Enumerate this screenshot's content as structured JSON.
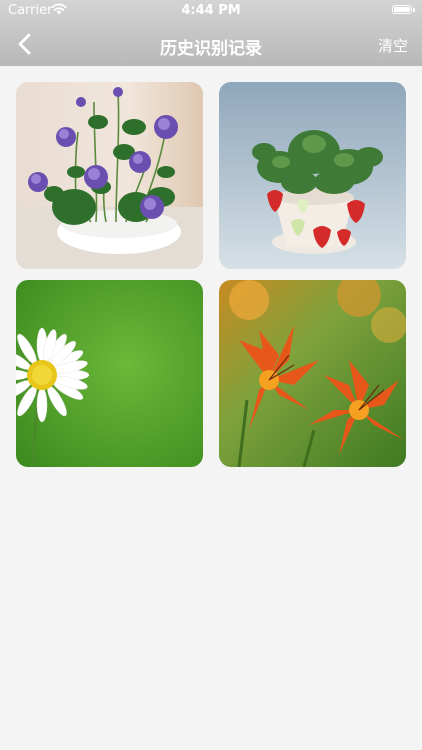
{
  "status_bar": {
    "carrier": "Carrier",
    "time": "4:44 PM"
  },
  "nav": {
    "title": "历史识别记录",
    "clear_label": "清空"
  },
  "history": {
    "items": [
      {
        "subject": "purple water lily bonsai"
      },
      {
        "subject": "potted strawberry plant"
      },
      {
        "subject": "white daisy"
      },
      {
        "subject": "orange daylily"
      }
    ]
  },
  "colors": {
    "header_top": "#d4d4d4",
    "header_bottom": "#b8b8b8",
    "background": "#f4f4f4"
  }
}
